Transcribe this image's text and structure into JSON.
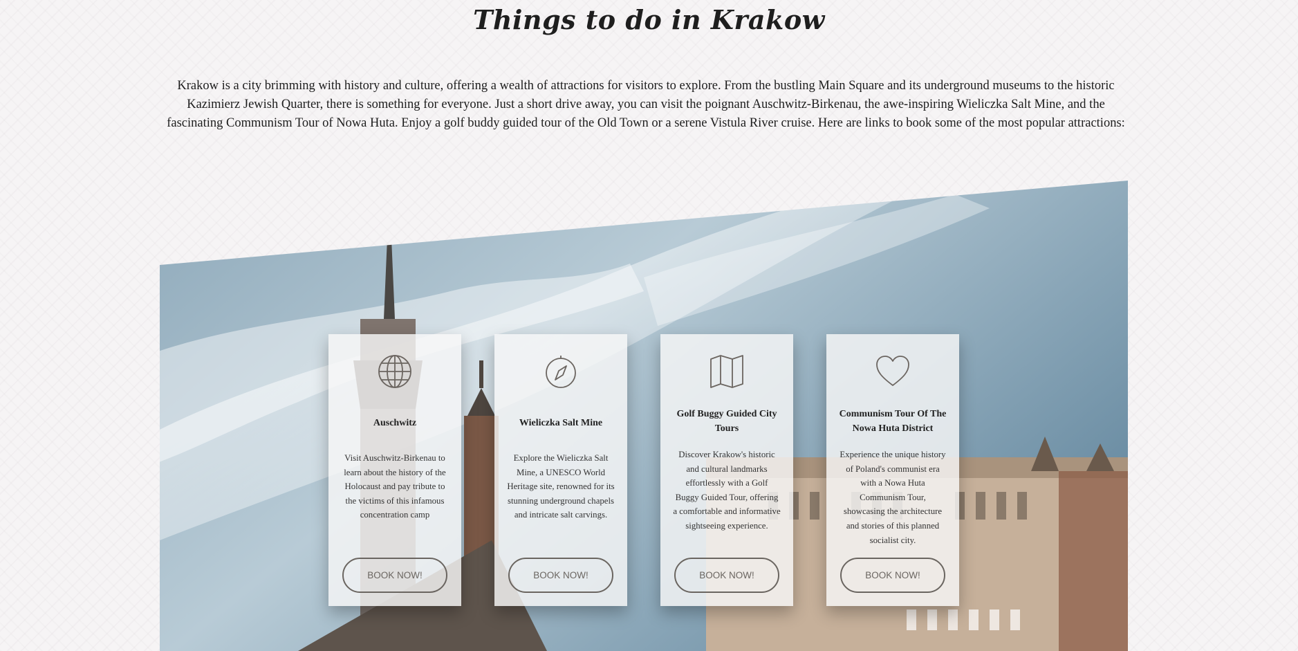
{
  "section": {
    "title": "Things to do in Krakow",
    "intro": "Krakow is a city brimming with history and culture, offering a wealth of attractions for visitors to explore. From the bustling Main Square and its underground museums to the historic Kazimierz Jewish Quarter, there is something for everyone. Just a short drive away, you can visit the poignant Auschwitz-Birkenau, the awe-inspiring Wieliczka Salt Mine, and the fascinating Communism Tour of Nowa Huta. Enjoy a golf buddy guided tour of the Old Town or a serene Vistula River cruise. Here are links to book some of the most popular attractions:"
  },
  "cards": [
    {
      "icon": "globe-icon",
      "title": "Auschwitz",
      "description": "Visit Auschwitz-Birkenau to learn about the history of the Holocaust and pay tribute to the victims of this infamous concentration camp",
      "button": "BOOK NOW!"
    },
    {
      "icon": "compass-icon",
      "title": "Wieliczka Salt Mine",
      "description": "Explore the Wieliczka Salt Mine, a UNESCO World Heritage site, renowned for its stunning underground chapels and intricate salt carvings.",
      "button": "BOOK NOW!"
    },
    {
      "icon": "map-icon",
      "title": "Golf Buggy Guided City Tours",
      "description": "Discover Krakow's historic and cultural landmarks effortlessly with a Golf Buggy Guided Tour, offering a comfortable and informative sightseeing experience.",
      "button": "BOOK NOW!"
    },
    {
      "icon": "heart-icon",
      "title": "Communism Tour Of The Nowa Huta District",
      "description": "Experience the unique history of Poland's communist era with a Nowa Huta Communism Tour, showcasing the architecture and stories of this planned socialist city.",
      "button": "BOOK NOW!"
    }
  ],
  "colors": {
    "background": "#f6f4f5",
    "sky": "#6e8fa3",
    "button_border": "#6a6560",
    "icon": "#6b6560"
  }
}
